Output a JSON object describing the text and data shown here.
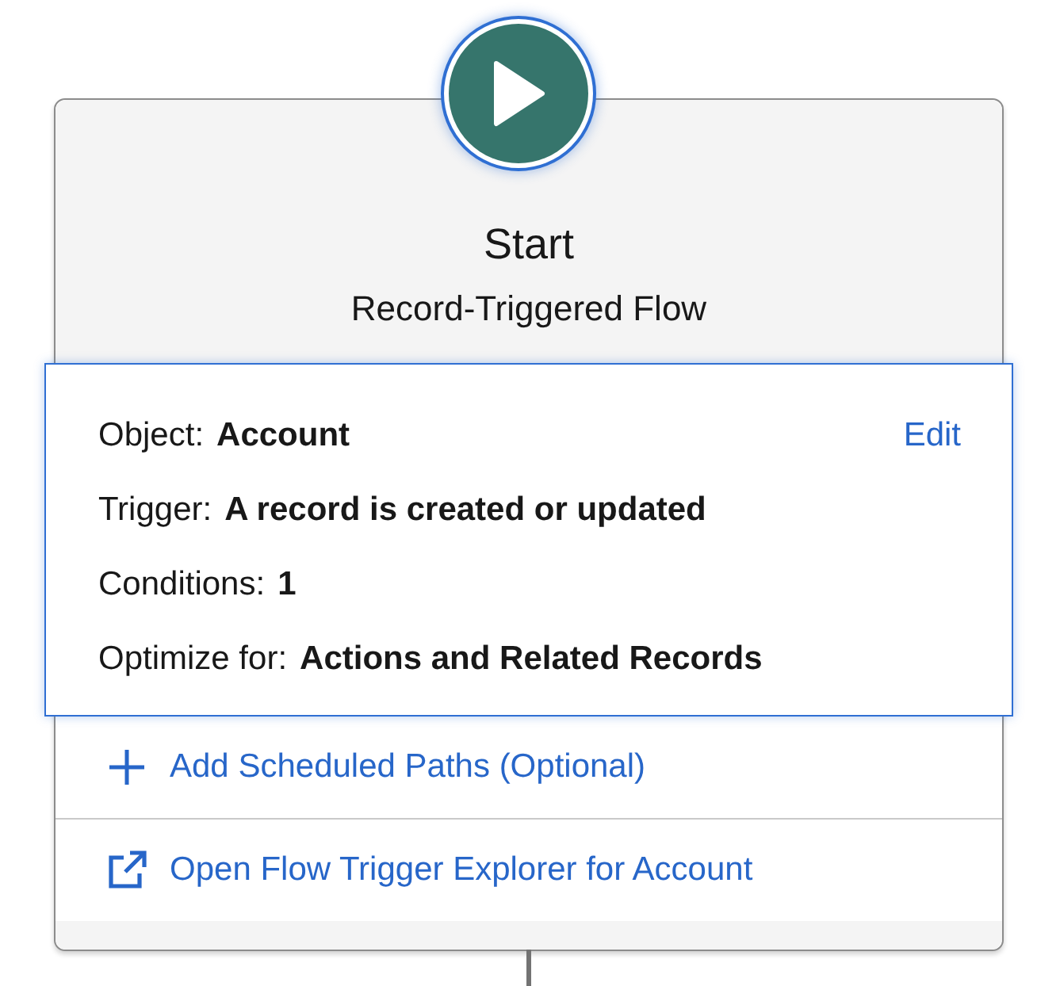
{
  "start": {
    "title": "Start",
    "subtitle": "Record-Triggered Flow"
  },
  "details": {
    "edit_link": "Edit",
    "rows": [
      {
        "label": "Object:",
        "value": "Account"
      },
      {
        "label": "Trigger:",
        "value": "A record is created or updated"
      },
      {
        "label": "Conditions:",
        "value": "1"
      },
      {
        "label": "Optimize for:",
        "value": "Actions and Related Records"
      }
    ]
  },
  "actions": [
    {
      "kind": "add",
      "label": "Add Scheduled Paths (Optional)"
    },
    {
      "kind": "external",
      "label": "Open Flow Trigger Explorer for Account"
    }
  ]
}
